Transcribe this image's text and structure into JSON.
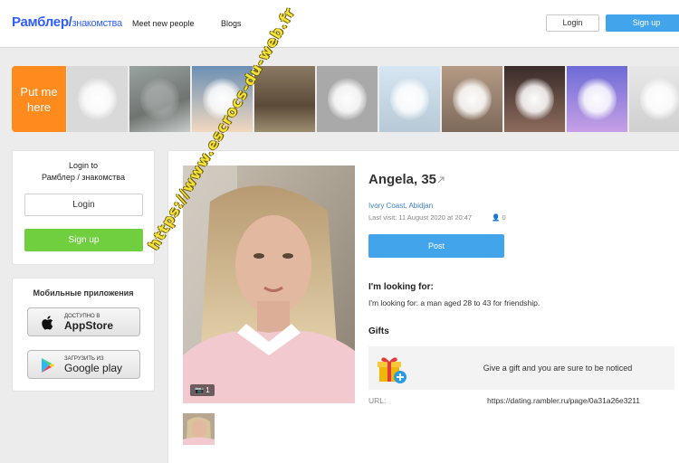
{
  "header": {
    "logo": "Рамблер/",
    "logo_sub": "знакомства",
    "nav": [
      "Meet new people",
      "Blogs"
    ],
    "login": "Login",
    "signup": "Sign up",
    "accent": "#315efb",
    "button_color": "#42a4ea"
  },
  "strip": {
    "put_me_here": "Put me here",
    "put_me_color": "#ff8a1e"
  },
  "sidebar": {
    "login_title_line1": "Login to",
    "login_title_line2": "Рамблер / знакомства",
    "login": "Login",
    "signup": "Sign up",
    "signup_color": "#6fcf3f",
    "apps_title": "Мобильные приложения",
    "appstore_small": "Доступно в",
    "appstore_big": "AppStore",
    "googleplay_small": "Загрузить из",
    "googleplay_big": "Google play"
  },
  "profile": {
    "name": "Angela, 35",
    "location": "Ivory Coast, Abidjan",
    "last_visit": "Last visit: 11 August 2020 at 20:47",
    "views": "0",
    "photo_count": "1",
    "post": "Post",
    "looking_title": "I'm looking for:",
    "looking_text": "I'm looking for: a man aged 28 to 43 for friendship.",
    "gifts_title": "Gifts",
    "gift_text": "Give a gift and you are sure to be noticed",
    "url_label": "URL:",
    "url": "https://dating.rambler.ru/page/0a31a26e3211"
  },
  "watermark": "https://www.escrocs-du-web.fr"
}
